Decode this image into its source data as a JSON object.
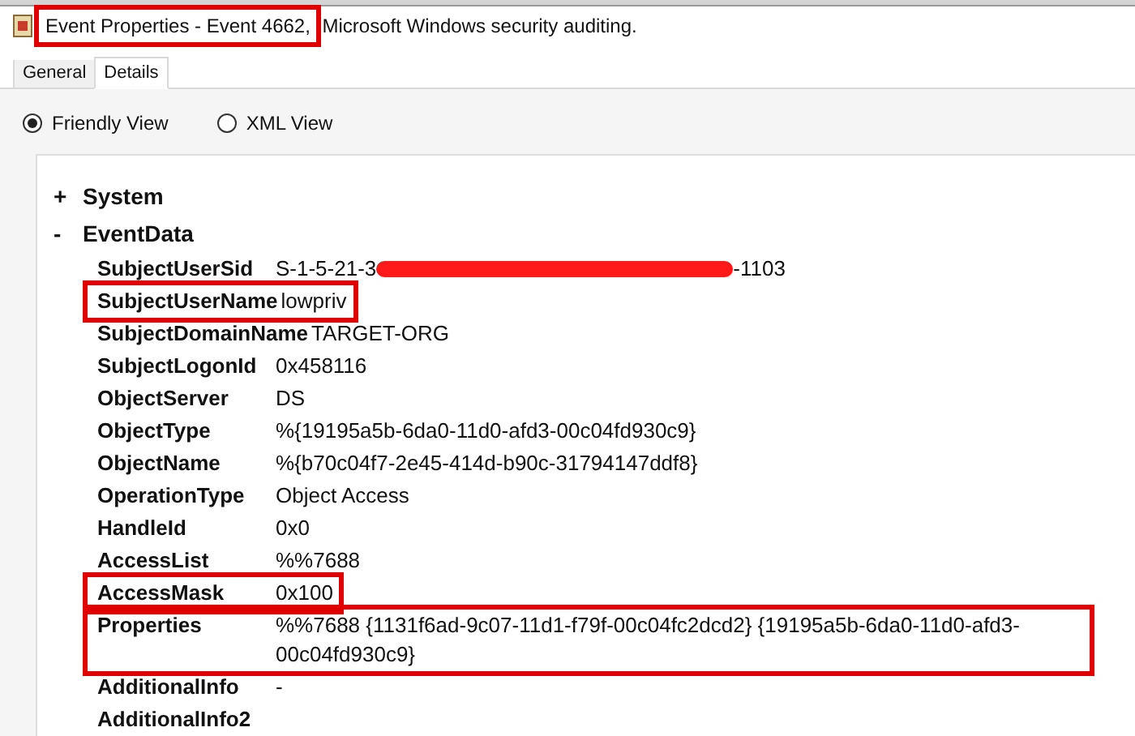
{
  "window": {
    "title_parts": [
      {
        "text": "Event Properties - Event 4662,",
        "highlighted": true
      },
      {
        "text": " Microsoft Windows security auditing.",
        "highlighted": false
      }
    ]
  },
  "tabs": [
    {
      "label": "General",
      "selected": false
    },
    {
      "label": "Details",
      "selected": true
    }
  ],
  "view_options": [
    {
      "label": "Friendly View",
      "selected": true
    },
    {
      "label": "XML View",
      "selected": false
    }
  ],
  "tree": [
    {
      "toggle": "+",
      "label": "System"
    },
    {
      "toggle": "-",
      "label": "EventData"
    }
  ],
  "fields": [
    {
      "name": "SubjectUserSid",
      "value": "S-1-5-21-3",
      "redacted": true,
      "value_after_redaction": "-1103",
      "highlighted": false
    },
    {
      "name": "SubjectUserName",
      "value": "lowpriv",
      "highlighted": true
    },
    {
      "name": "SubjectDomainName",
      "value": "TARGET-ORG",
      "highlighted": false
    },
    {
      "name": "SubjectLogonId",
      "value": "0x458116",
      "highlighted": false
    },
    {
      "name": "ObjectServer",
      "value": "DS",
      "highlighted": false
    },
    {
      "name": "ObjectType",
      "value": "%{19195a5b-6da0-11d0-afd3-00c04fd930c9}",
      "highlighted": false
    },
    {
      "name": "ObjectName",
      "value": "%{b70c04f7-2e45-414d-b90c-31794147ddf8}",
      "highlighted": false
    },
    {
      "name": "OperationType",
      "value": "Object Access",
      "highlighted": false
    },
    {
      "name": "HandleId",
      "value": "0x0",
      "highlighted": false
    },
    {
      "name": "AccessList",
      "value": "%%7688",
      "highlighted": false
    },
    {
      "name": "AccessMask",
      "value": "0x100",
      "highlighted": true
    },
    {
      "name": "Properties",
      "value": "%%7688 {1131f6ad-9c07-11d1-f79f-00c04fc2dcd2} {19195a5b-6da0-11d0-afd3-00c04fd930c9}",
      "highlighted": true,
      "wide": true
    },
    {
      "name": "AdditionalInfo",
      "value": "-",
      "highlighted": false
    },
    {
      "name": "AdditionalInfo2",
      "highlighted": false
    }
  ]
}
